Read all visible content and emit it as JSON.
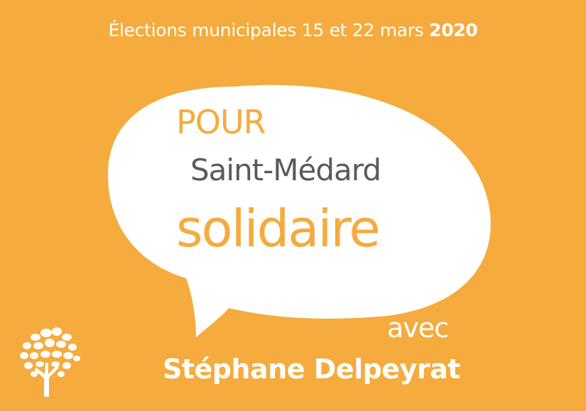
{
  "header": {
    "text": "Élections municipales 15 et 22 mars",
    "year": "2020"
  },
  "bubble": {
    "line1": "POUR",
    "line2": "Saint-Médard",
    "line3": "solidaire"
  },
  "candidate": {
    "prefix": "avec",
    "name": "Stéphane Delpeyrat"
  },
  "icons": {
    "logo": "tree-icon",
    "bubble": "speech-bubble-icon"
  },
  "colors": {
    "background": "#f5ab3d",
    "accent": "#f5ab3d",
    "text_dark": "#5a5a5a",
    "text_light": "#ffffff"
  }
}
